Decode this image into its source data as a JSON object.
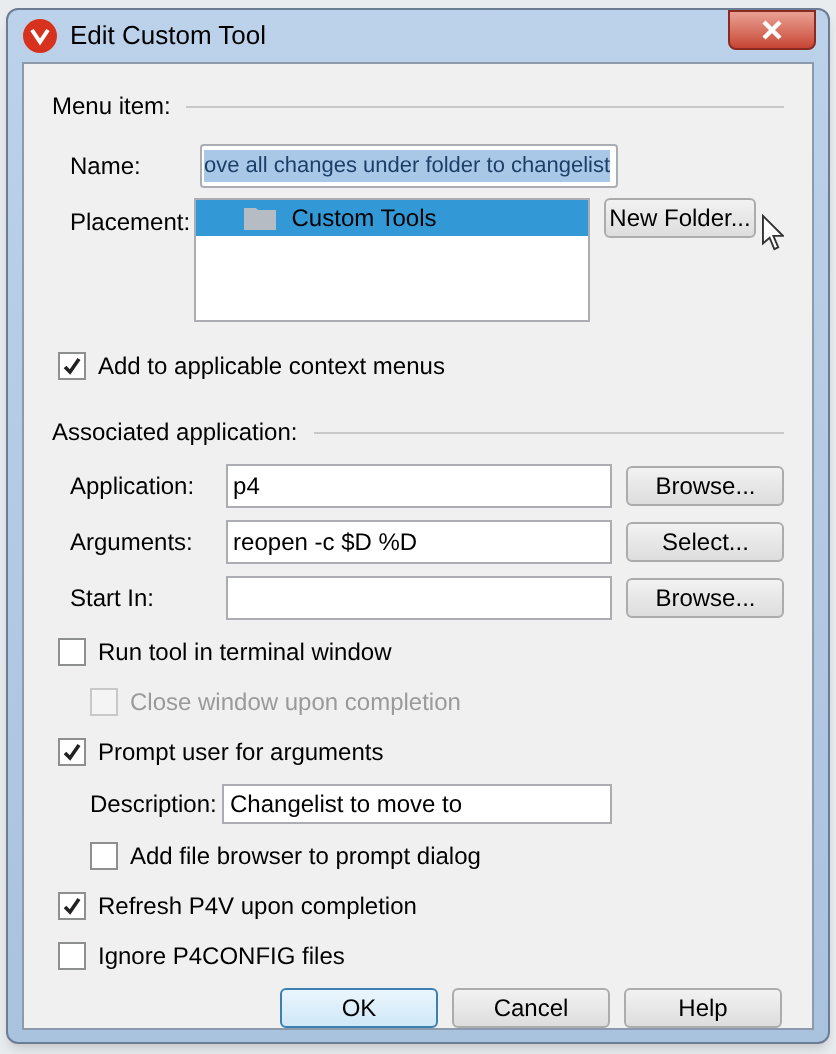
{
  "window": {
    "title": "Edit Custom Tool"
  },
  "menu_item": {
    "title": "Menu item:",
    "name": {
      "label": "Name:",
      "value": "ove all changes under folder to changelist",
      "text_selected": true
    },
    "placement": {
      "label": "Placement:",
      "items": [
        {
          "label": "Custom Tools",
          "selected": true
        }
      ]
    },
    "new_folder_button": "New Folder...",
    "context_checkbox": {
      "label": "Add to applicable context menus",
      "checked": true
    }
  },
  "associated_application": {
    "title": "Associated application:",
    "fields": [
      {
        "label": "Application:",
        "value": "p4",
        "button": "Browse..."
      },
      {
        "label": "Arguments:",
        "value": "reopen -c $D %D",
        "button": "Select..."
      },
      {
        "label": "Start In:",
        "button": "Browse..."
      }
    ],
    "options": [
      {
        "kind": "checkbox",
        "label": "Run tool in terminal window",
        "checked": false,
        "disabled": false,
        "children": [
          {
            "kind": "checkbox",
            "label": "Close window upon completion",
            "checked": false,
            "disabled": true
          }
        ]
      },
      {
        "kind": "checkbox",
        "label": "Prompt user for arguments",
        "checked": true,
        "disabled": false,
        "children": [
          {
            "kind": "field",
            "label": "Description:",
            "value": "Changelist to move to"
          },
          {
            "kind": "checkbox",
            "label": "Add file browser to prompt dialog",
            "checked": false,
            "disabled": false
          }
        ]
      },
      {
        "kind": "checkbox",
        "label": "Refresh P4V upon completion",
        "checked": true,
        "disabled": false
      },
      {
        "kind": "checkbox",
        "label": "Ignore P4CONFIG files",
        "checked": false,
        "disabled": false
      }
    ]
  },
  "buttons": [
    {
      "label": "OK",
      "default": true
    },
    {
      "label": "Cancel",
      "default": false
    },
    {
      "label": "Help",
      "default": false
    }
  ]
}
